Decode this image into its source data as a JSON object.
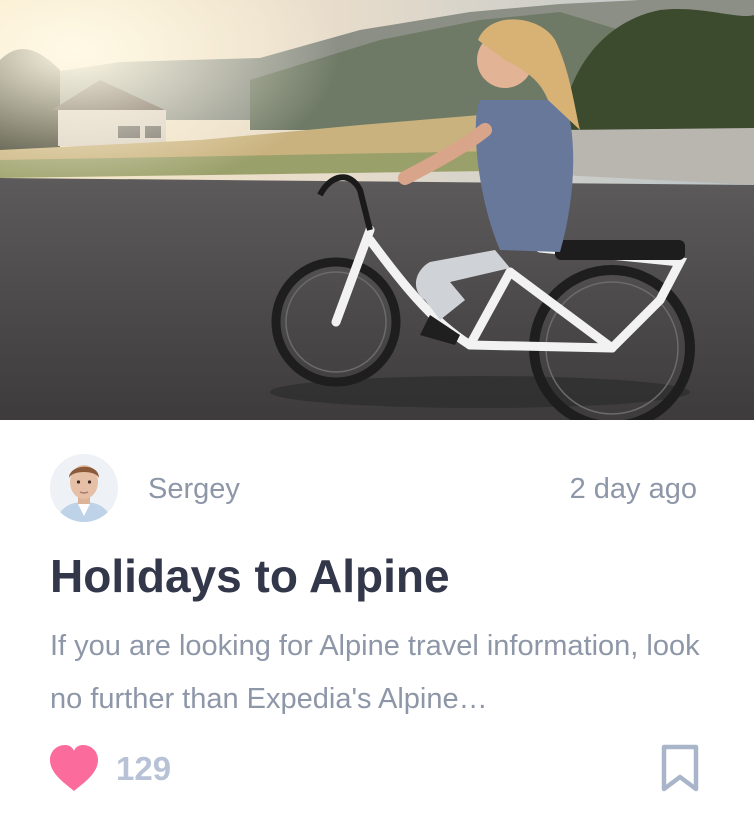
{
  "post": {
    "author_name": "Sergey",
    "time_ago": "2 day ago",
    "title": "Holidays to Alpine",
    "excerpt": "If you are looking for Alpine travel information, look no further than Expedia's Alpine…",
    "likes": "129"
  },
  "icons": {
    "like": "heart-icon",
    "bookmark": "bookmark-icon"
  },
  "colors": {
    "heart": "#fb6b9b",
    "title": "#33374a",
    "meta_text": "#8e97a8",
    "like_count": "#b7c2d6",
    "bookmark": "#a9b5c9"
  }
}
